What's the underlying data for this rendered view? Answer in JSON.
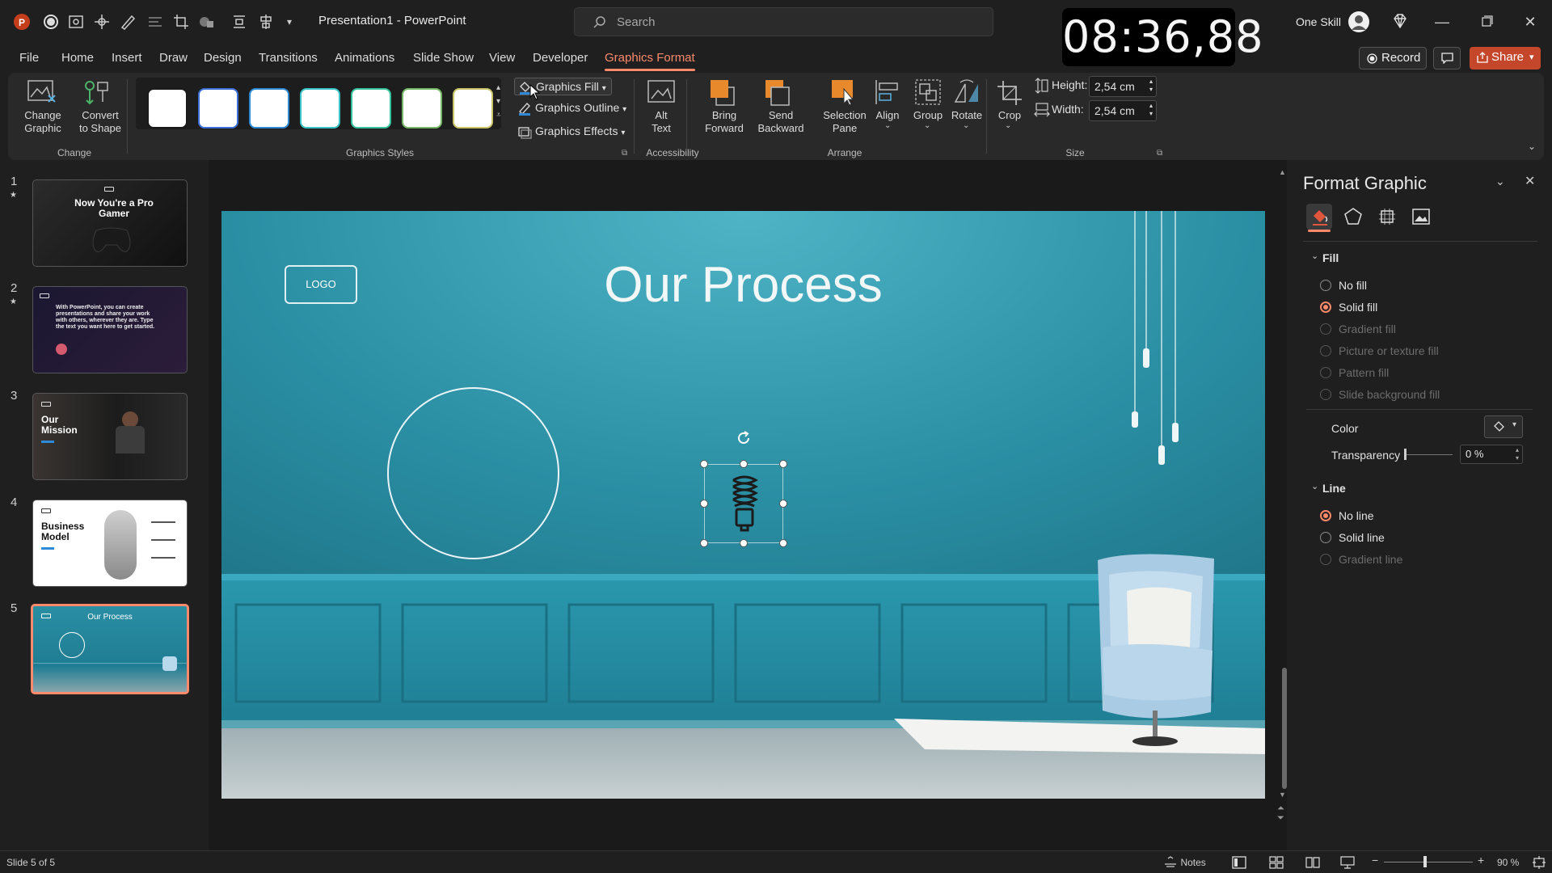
{
  "app": {
    "doc_title": "Presentation1  -  PowerPoint",
    "search_placeholder": "Search",
    "clock": "08:36,88",
    "user_name": "One Skill"
  },
  "menu": {
    "tabs": [
      "File",
      "Home",
      "Insert",
      "Draw",
      "Design",
      "Transitions",
      "Animations",
      "Slide Show",
      "View",
      "Developer",
      "Graphics Format"
    ],
    "active_tab": "Graphics Format",
    "record_label": "Record",
    "share_label": "Share"
  },
  "ribbon": {
    "change": {
      "change_graphic": "Change\nGraphic",
      "convert_to_shape": "Convert\nto Shape",
      "group_label": "Change"
    },
    "styles": {
      "group_label": "Graphics Styles",
      "swatch_colors": [
        "#1a1a1a",
        "#3b6fd6",
        "#2e8ad6",
        "#36c4c9",
        "#36c49e",
        "#76b865",
        "#c9c468"
      ]
    },
    "graphics_fill": "Graphics Fill",
    "graphics_outline": "Graphics Outline",
    "graphics_effects": "Graphics Effects",
    "accessibility": {
      "alt_text": "Alt\nText",
      "group_label": "Accessibility"
    },
    "arrange": {
      "bring_forward": "Bring\nForward",
      "send_backward": "Send\nBackward",
      "selection_pane": "Selection\nPane",
      "align": "Align",
      "group": "Group",
      "rotate": "Rotate",
      "group_label": "Arrange"
    },
    "size": {
      "crop": "Crop",
      "height_label": "Height:",
      "height_value": "2,54 cm",
      "width_label": "Width:",
      "width_value": "2,54 cm",
      "group_label": "Size"
    }
  },
  "slides": [
    {
      "num": "1",
      "starred": true,
      "text": "Now You're a Pro Gamer"
    },
    {
      "num": "2",
      "starred": true,
      "text": "With PowerPoint, you can create presentations and share your work with others, wherever they are. Type the text you want here to get started."
    },
    {
      "num": "3",
      "starred": false,
      "text": "Our Mission"
    },
    {
      "num": "4",
      "starred": false,
      "text": "Business Model"
    },
    {
      "num": "5",
      "starred": false,
      "text": "Our Process",
      "selected": true
    }
  ],
  "slide": {
    "title": "Our Process",
    "logo_text": "LOGO",
    "accent_teal": "#2a8ea3"
  },
  "format_pane": {
    "title": "Format Graphic",
    "tab_icons": [
      "fill-line-icon",
      "effects-pentagon-icon",
      "size-properties-icon",
      "picture-icon"
    ],
    "fill": {
      "section_label": "Fill",
      "options": [
        {
          "label": "No fill",
          "selected": false,
          "enabled": true
        },
        {
          "label": "Solid fill",
          "selected": true,
          "enabled": true
        },
        {
          "label": "Gradient fill",
          "selected": false,
          "enabled": false
        },
        {
          "label": "Picture or texture fill",
          "selected": false,
          "enabled": false
        },
        {
          "label": "Pattern fill",
          "selected": false,
          "enabled": false
        },
        {
          "label": "Slide background fill",
          "selected": false,
          "enabled": false
        }
      ],
      "color_label": "Color",
      "transparency_label": "Transparency",
      "transparency_value": "0 %"
    },
    "line": {
      "section_label": "Line",
      "options": [
        {
          "label": "No line",
          "selected": true,
          "enabled": true
        },
        {
          "label": "Solid line",
          "selected": false,
          "enabled": true
        },
        {
          "label": "Gradient line",
          "selected": false,
          "enabled": false
        }
      ]
    }
  },
  "status": {
    "slide_info": "Slide 5 of 5",
    "notes_label": "Notes",
    "zoom": "90 %"
  }
}
